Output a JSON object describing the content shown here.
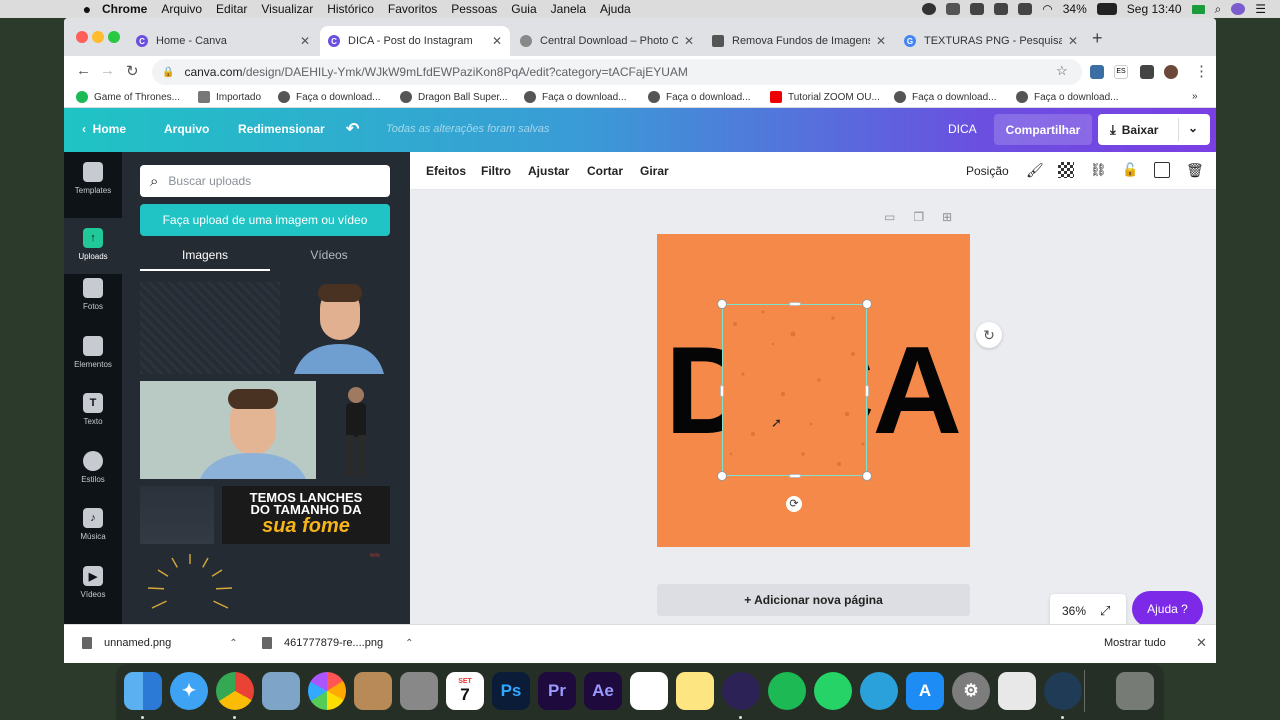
{
  "menubar": {
    "app": "Chrome",
    "items": [
      "Arquivo",
      "Editar",
      "Visualizar",
      "Histórico",
      "Favoritos",
      "Pessoas",
      "Guia",
      "Janela",
      "Ajuda"
    ],
    "battery": "34%",
    "clock": "Seg 13:40"
  },
  "browser": {
    "tabs": [
      {
        "title": "Home - Canva",
        "favicon": "canva-icon",
        "color": "#6b4fe0"
      },
      {
        "title": "DICA - Post do Instagram",
        "favicon": "canva-icon",
        "color": "#6b4fe0"
      },
      {
        "title": "Central Download – Photo Can",
        "favicon": "globe-icon",
        "color": "#888888"
      },
      {
        "title": "Remova Fundos de Imagens –",
        "favicon": "layers-icon",
        "color": "#555555"
      },
      {
        "title": "TEXTURAS PNG - Pesquisa Go",
        "favicon": "google-icon",
        "color": "#4285f4"
      }
    ],
    "url_domain": "canva.com",
    "url_path": "/design/DAEHILy-Ymk/WJkW9mLfdEWPaziKon8PqA/edit?category=tACFajEYUAM",
    "bookmarks": [
      "Game of Thrones...",
      "Importado",
      "Faça o download...",
      "Dragon Ball Super...",
      "Faça o download...",
      "Faça o download...",
      "Tutorial ZOOM OU...",
      "Faça o download...",
      "Faça o download..."
    ]
  },
  "header": {
    "home": "Home",
    "arquivo": "Arquivo",
    "redimensionar": "Redimensionar",
    "save_status": "Todas as alterações foram salvas",
    "design_name": "DICA",
    "share": "Compartilhar",
    "download": "Baixar"
  },
  "rail": [
    {
      "label": "Templates",
      "icon": "templates-icon"
    },
    {
      "label": "Uploads",
      "icon": "upload-cloud-icon"
    },
    {
      "label": "Fotos",
      "icon": "photos-icon"
    },
    {
      "label": "Elementos",
      "icon": "elements-icon"
    },
    {
      "label": "Texto",
      "icon": "text-icon"
    },
    {
      "label": "Estilos",
      "icon": "palette-icon"
    },
    {
      "label": "Música",
      "icon": "music-icon"
    },
    {
      "label": "Vídeos",
      "icon": "video-icon"
    }
  ],
  "panel": {
    "search_placeholder": "Buscar uploads",
    "upload_button": "Faça upload de uma imagem ou vídeo",
    "tab_images": "Imagens",
    "tab_videos": "Vídeos",
    "thumb_caption_line1": "TEMOS LANCHES",
    "thumb_caption_line2": "DO TAMANHO DA",
    "thumb_caption_line3": "sua fome"
  },
  "toolbar": {
    "efeitos": "Efeitos",
    "filtro": "Filtro",
    "ajustar": "Ajustar",
    "cortar": "Cortar",
    "girar": "Girar",
    "posicao": "Posição"
  },
  "canvas": {
    "text": "DICA",
    "bg_color": "#f5894a",
    "add_page": "+ Adicionar nova página",
    "zoom": "36%",
    "help": "Ajuda ?"
  },
  "downloads": [
    {
      "name": "unnamed.png"
    },
    {
      "name": "461777879-re....png"
    }
  ],
  "downloads_show_all": "Mostrar tudo",
  "dock": [
    "finder-icon",
    "safari-icon",
    "chrome-icon",
    "preview-icon",
    "photos-icon",
    "contacts-icon",
    "calculator-icon",
    "calendar-icon",
    "photoshop-icon",
    "premiere-icon",
    "after-effects-icon",
    "reminders-icon",
    "notes-icon",
    "eclipse-icon",
    "spotify-icon",
    "whatsapp-icon",
    "telegram-icon",
    "app-store-icon",
    "system-preferences-icon",
    "roblox-icon",
    "quicktime-icon",
    "trash-icon"
  ],
  "calendar_day": "7",
  "calendar_month": "SET"
}
